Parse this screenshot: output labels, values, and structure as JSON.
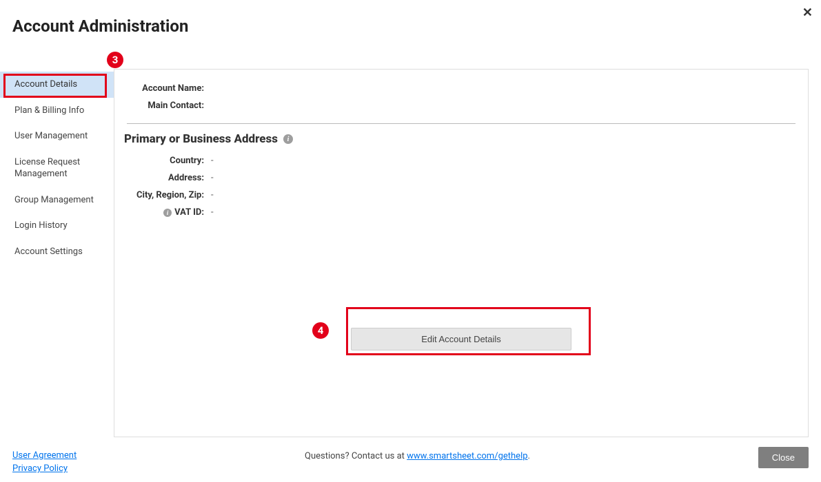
{
  "header": {
    "title": "Account Administration",
    "close_x": "✕"
  },
  "sidebar": {
    "items": [
      {
        "label": "Account Details",
        "active": true
      },
      {
        "label": "Plan & Billing Info"
      },
      {
        "label": "User Management"
      },
      {
        "label": "License Request Management"
      },
      {
        "label": "Group Management"
      },
      {
        "label": "Login History"
      },
      {
        "label": "Account Settings"
      }
    ]
  },
  "annotations": {
    "badge3": "3",
    "badge4": "4"
  },
  "details": {
    "account_name_label": "Account Name:",
    "account_name_value": "",
    "main_contact_label": "Main Contact:",
    "main_contact_value": ""
  },
  "address_section": {
    "heading": "Primary or Business Address",
    "rows": {
      "country_label": "Country:",
      "country_value": "-",
      "address_label": "Address:",
      "address_value": "-",
      "city_label": "City, Region, Zip:",
      "city_value": "-",
      "vat_label": "VAT ID:",
      "vat_value": "-"
    }
  },
  "buttons": {
    "edit": "Edit Account Details",
    "close": "Close"
  },
  "footer": {
    "user_agreement": "User Agreement",
    "privacy_policy": "Privacy Policy",
    "help_prefix": "Questions? Contact us at ",
    "help_link": "www.smartsheet.com/gethelp",
    "help_suffix": "."
  }
}
